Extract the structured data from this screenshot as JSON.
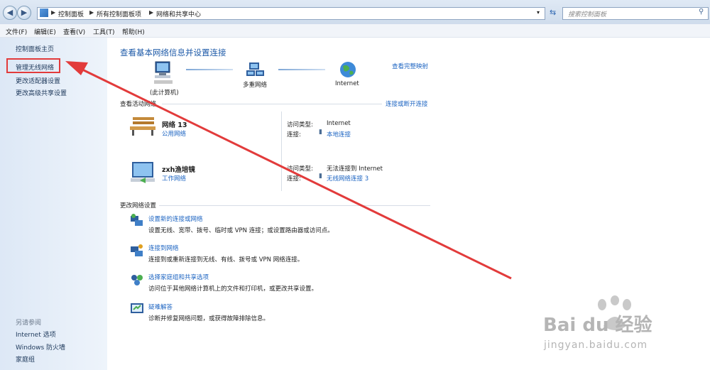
{
  "address": {
    "crumbs": [
      "控制面板",
      "所有控制面板项",
      "网络和共享中心"
    ],
    "search_placeholder": "搜索控制面板"
  },
  "menu": [
    "文件(F)",
    "编辑(E)",
    "查看(V)",
    "工具(T)",
    "帮助(H)"
  ],
  "sidebar": {
    "items": [
      "控制面板主页",
      "管理无线网络",
      "更改适配器设置",
      "更改高级共享设置"
    ],
    "see_also_label": "另请参阅",
    "see_also": [
      "Internet 选项",
      "Windows 防火墙",
      "家庭组"
    ]
  },
  "main": {
    "heading": "查看基本网络信息并设置连接",
    "view_full_map": "查看完整映射",
    "map": {
      "computer_label": "(此计算机)",
      "multi_label": "多重网络",
      "internet_label": "Internet"
    },
    "active_networks_label": "查看活动网络",
    "connect_disconnect": "连接或断开连接",
    "networks": [
      {
        "name": "网络 13",
        "type": "公用网络",
        "access_label": "访问类型:",
        "access_value": "Internet",
        "conn_label": "连接:",
        "conn_value": "本地连接"
      },
      {
        "name": "zxh渔培镜",
        "type": "工作网络",
        "access_label": "访问类型:",
        "access_value": "无法连接到 Internet",
        "conn_label": "连接:",
        "conn_value": "无线网络连接 3"
      }
    ],
    "change_settings_label": "更改网络设置",
    "tasks": [
      {
        "title": "设置新的连接或网络",
        "desc": "设置无线、宽带、拨号、临时或 VPN 连接；或设置路由器或访问点。"
      },
      {
        "title": "连接到网络",
        "desc": "连接到或重新连接到无线、有线、拨号或 VPN 网络连接。"
      },
      {
        "title": "选择家庭组和共享选项",
        "desc": "访问位于其他网络计算机上的文件和打印机，或更改共享设置。"
      },
      {
        "title": "疑难解答",
        "desc": "诊断并修复网络问题，或获得故障排除信息。"
      }
    ]
  },
  "watermark": {
    "brand": "Bai du 经验",
    "url": "jingyan.baidu.com"
  },
  "colors": {
    "link": "#1c64c2",
    "annotation": "#e23b3b"
  }
}
